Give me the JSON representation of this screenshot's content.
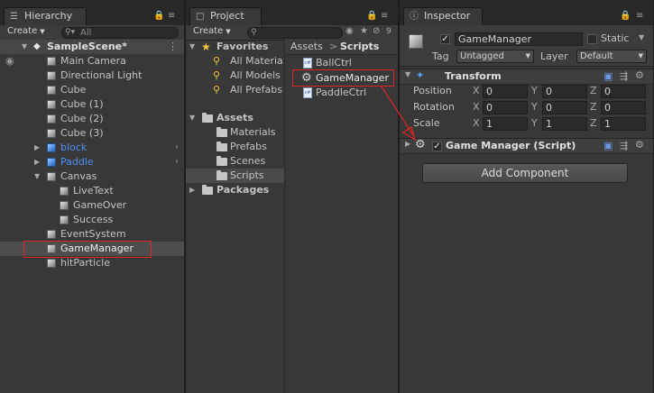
{
  "hierarchy": {
    "tab_label": "Hierarchy",
    "create_label": "Create",
    "search_value": "All",
    "scene_name": "SampleScene*",
    "items": [
      {
        "label": "Main Camera",
        "indent": 1,
        "kind": "gray"
      },
      {
        "label": "Directional Light",
        "indent": 1,
        "kind": "gray"
      },
      {
        "label": "Cube",
        "indent": 1,
        "kind": "gray"
      },
      {
        "label": "Cube (1)",
        "indent": 1,
        "kind": "gray"
      },
      {
        "label": "Cube (2)",
        "indent": 1,
        "kind": "gray"
      },
      {
        "label": "Cube (3)",
        "indent": 1,
        "kind": "gray"
      },
      {
        "label": "block",
        "indent": 1,
        "kind": "prefab"
      },
      {
        "label": "Paddle",
        "indent": 1,
        "kind": "prefab"
      },
      {
        "label": "Canvas",
        "indent": 1,
        "kind": "gray"
      },
      {
        "label": "LiveText",
        "indent": 2,
        "kind": "gray"
      },
      {
        "label": "GameOver",
        "indent": 2,
        "kind": "gray"
      },
      {
        "label": "Success",
        "indent": 2,
        "kind": "gray"
      },
      {
        "label": "EventSystem",
        "indent": 1,
        "kind": "gray"
      },
      {
        "label": "GameManager",
        "indent": 1,
        "kind": "gray"
      },
      {
        "label": "hitParticle",
        "indent": 1,
        "kind": "gray"
      }
    ]
  },
  "project": {
    "tab_label": "Project",
    "create_label": "Create",
    "visible_count": "9",
    "favorites_label": "Favorites",
    "favorites": [
      "All Materia",
      "All Models",
      "All Prefabs"
    ],
    "assets_label": "Assets",
    "asset_folders": [
      "Materials",
      "Prefabs",
      "Scenes",
      "Scripts"
    ],
    "packages_label": "Packages",
    "breadcrumb_root": "Assets",
    "breadcrumb_sep": ">",
    "breadcrumb_current": "Scripts",
    "files": [
      "BallCtrl",
      "GameManager",
      "PaddleCtrl"
    ]
  },
  "inspector": {
    "tab_label": "Inspector",
    "object_name": "GameManager",
    "static_label": "Static",
    "tag_label": "Tag",
    "tag_value": "Untagged",
    "layer_label": "Layer",
    "layer_value": "Default",
    "transform_title": "Transform",
    "position_label": "Position",
    "rotation_label": "Rotation",
    "scale_label": "Scale",
    "axis_x": "X",
    "axis_y": "Y",
    "axis_z": "Z",
    "position": {
      "x": "0",
      "y": "0",
      "z": "0"
    },
    "rotation": {
      "x": "0",
      "y": "0",
      "z": "0"
    },
    "scale": {
      "x": "1",
      "y": "1",
      "z": "1"
    },
    "script_title": "Game Manager (Script)",
    "add_component_label": "Add Component"
  },
  "colors": {
    "panel_bg": "#383838",
    "selection": "#4d4d4d",
    "prefab_text": "#4f8ff7",
    "highlight_box": "#e02424"
  },
  "icons": {
    "hierarchy_tab": "hierarchy-icon",
    "project_tab": "folder-icon",
    "inspector_tab": "info-icon",
    "favorites": "star-icon",
    "search_items": "magnifier-icon",
    "script_file": "cs-script-icon",
    "gameobject": "cube-icon",
    "settings": "gear-icon"
  }
}
